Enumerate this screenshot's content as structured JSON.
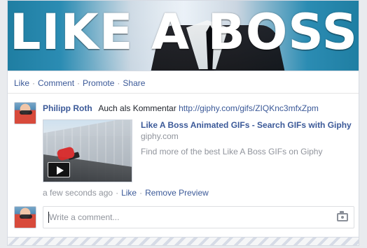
{
  "post": {
    "meme_caption": "LIKE A BOSS",
    "actions": [
      "Like",
      "Comment",
      "Promote",
      "Share"
    ]
  },
  "comment": {
    "author": "Philipp Roth",
    "text": "Auch als Kommentar",
    "link": "http://giphy.com/gifs/ZIQKnc3mfxZpm"
  },
  "preview": {
    "title": "Like A Boss Animated GIFs - Search GIFs with Giphy",
    "domain": "giphy.com",
    "description": "Find more of the best Like A Boss GIFs on Giphy"
  },
  "meta": {
    "time": "a few seconds ago",
    "like": "Like",
    "remove_preview": "Remove Preview"
  },
  "composer": {
    "placeholder": "Write a comment..."
  },
  "icons": {
    "play": "play-icon",
    "camera": "camera-icon"
  },
  "colors": {
    "link_blue": "#3b5998",
    "muted_text": "#90949c"
  }
}
